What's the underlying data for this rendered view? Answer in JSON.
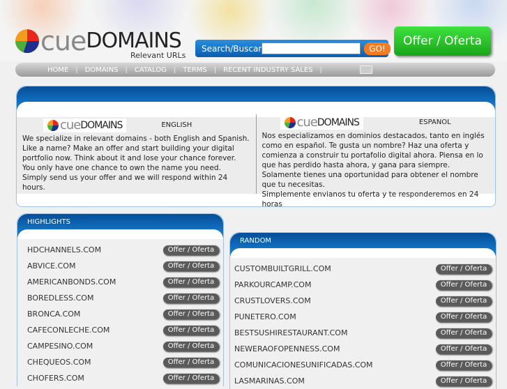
{
  "header": {
    "brand_cue": "cue",
    "brand_domains": "DOMAINS",
    "tagline": "Relevant URLs",
    "search_label": "Search/Buscar",
    "search_value": "",
    "go_label": "GO!",
    "offer_label": "Offer / Oferta"
  },
  "nav": {
    "items": [
      "HOME",
      "DOMAINS",
      "CATALOG",
      "TERMS",
      "RECENT INDUSTRY SALES"
    ]
  },
  "intro": {
    "english": {
      "heading": "ENGLISH",
      "lines": [
        "We specialize in relevant domains - both English and Spanish. Like a name? Make an offer and start building your digital portfolio now. Think about it and lose your chance forever. You only have one chance to own the name you need.",
        "Simply send us your offer and we will respond within 24 hours."
      ]
    },
    "spanish": {
      "heading": "ESPANOL",
      "lines": [
        "Nos especializamos en dominios destacados, tanto en inglés como en español. Te gusta un nombre? Haz una oferta y comienza a construir tu portafolio digital ahora. Piensa en lo que has perdido hasta ahora, y gana para siempre. Solamente tienes una oportunidad para obtener el nombre que tu necesitas.",
        "Simplemente envianos tu oferta y te responderemos en 24 horas"
      ]
    }
  },
  "highlights": {
    "title": "HIGHLIGHTS",
    "button": "Offer / Oferta",
    "domains": [
      "HDCHANNELS.COM",
      "ABVICE.COM",
      "AMERICANBONDS.COM",
      "BOREDLESS.COM",
      "BRONCA.COM",
      "CAFECONLECHE.COM",
      "CAMPESINO.COM",
      "CHEQUEOS.COM",
      "CHOFERS.COM"
    ]
  },
  "random": {
    "title": "RANDOM",
    "button": "Offer / Oferta",
    "domains": [
      "CUSTOMBUILTGRILL.COM",
      "PARKOURCAMP.COM",
      "CRUSTLOVERS.COM",
      "PUNETERO.COM",
      "BESTSUSHIRESTAURANT.COM",
      "NEWERAOFOPENNESS.COM",
      "COMUNICACIONESUNIFICADAS.COM",
      "LASMARINAS.COM"
    ]
  }
}
